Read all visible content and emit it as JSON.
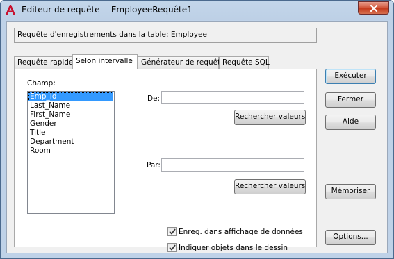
{
  "window": {
    "title": "Editeur de requête -- EmployeeRequête1"
  },
  "info": {
    "text": "Requête d'enregistrements dans la table:  Employee"
  },
  "tabs": [
    {
      "label": "Requête rapide",
      "active": false
    },
    {
      "label": "Selon intervalle",
      "active": true
    },
    {
      "label": "Générateur de requête",
      "active": false
    },
    {
      "label": "Requête SQL",
      "active": false
    }
  ],
  "panel": {
    "champ_label": "Champ:",
    "fields": [
      "Emp_Id",
      "Last_Name",
      "First_Name",
      "Gender",
      "Title",
      "Department",
      "Room"
    ],
    "selected_field": "Emp_Id",
    "de_label": "De:",
    "de_value": "",
    "par_label": "Par:",
    "par_value": "",
    "search_button_1": "Rechercher valeurs",
    "search_button_2": "Rechercher valeurs",
    "checkbox_1": {
      "label": "Enreg. dans affichage de données",
      "checked": true
    },
    "checkbox_2": {
      "label": "Indiquer objets dans le dessin",
      "checked": true
    }
  },
  "side_buttons": {
    "execute": "Exécuter",
    "close": "Fermer",
    "help": "Aide",
    "memorize": "Mémoriser",
    "options": "Options..."
  },
  "colors": {
    "title_bar": "#bfd2e8",
    "selection": "#3399ff",
    "close_button": "#c43b1d",
    "app_icon": "#c8102e"
  },
  "icons": {
    "app": "autocad-a-icon",
    "close": "close-x-icon",
    "check": "checkmark-icon"
  }
}
